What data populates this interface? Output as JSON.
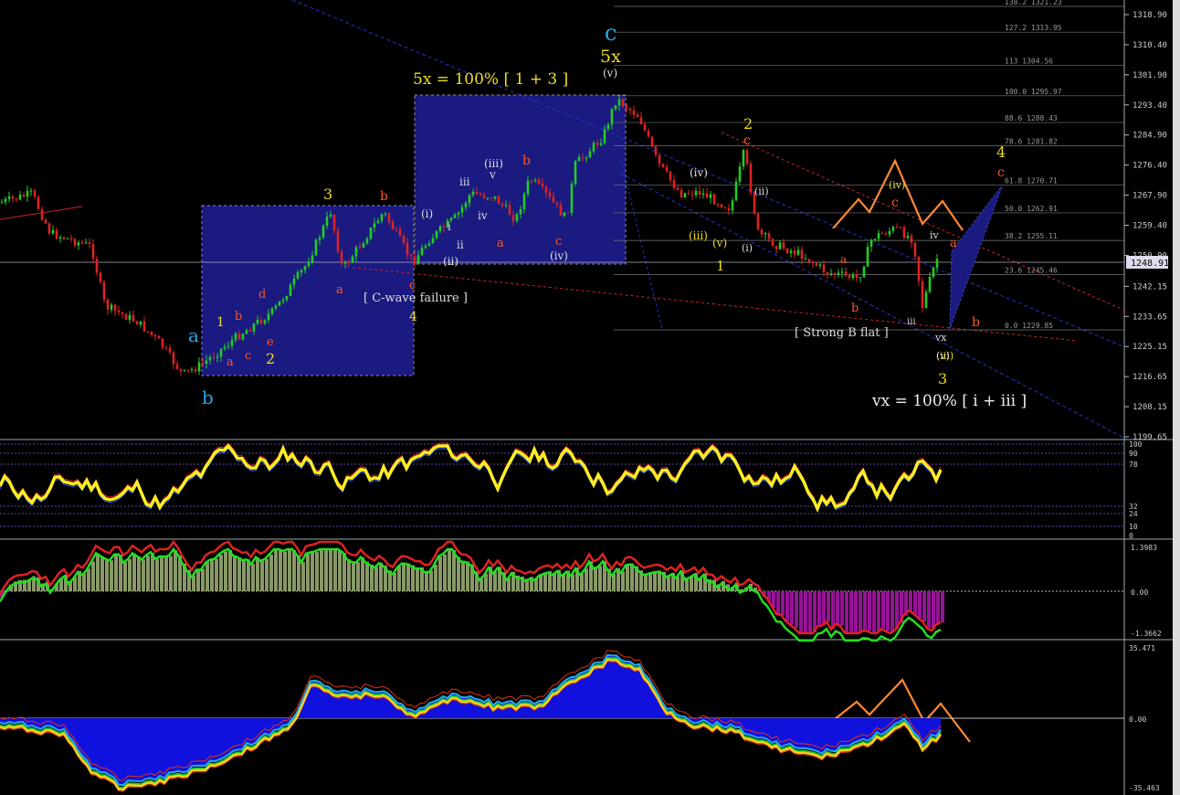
{
  "chart_data": {
    "type": "line",
    "main": {
      "y_axis_labels": [
        "1318.90",
        "1310.40",
        "1301.90",
        "1293.40",
        "1284.90",
        "1276.40",
        "1267.90",
        "1259.40",
        "1250.90",
        "1242.15",
        "1233.65",
        "1225.15",
        "1216.65",
        "1208.15",
        "1199.65"
      ],
      "current_price": "1248.91",
      "fib_levels": [
        {
          "label": "138.2 1321.23",
          "value": 1321.23
        },
        {
          "label": "127.2 1313.95",
          "value": 1313.95
        },
        {
          "label": "113 1304.56",
          "value": 1304.56
        },
        {
          "label": "100.0 1295.97",
          "value": 1295.97
        },
        {
          "label": "88.6 1288.43",
          "value": 1288.43
        },
        {
          "label": "78.6 1281.82",
          "value": 1281.82
        },
        {
          "label": "61.8 1270.71",
          "value": 1270.71
        },
        {
          "label": "50.0 1262.91",
          "value": 1262.91
        },
        {
          "label": "38.2 1255.11",
          "value": 1255.11
        },
        {
          "label": "23.6 1245.46",
          "value": 1245.46
        },
        {
          "label": "0.0 1229.85",
          "value": 1229.85
        }
      ],
      "annotations": {
        "five_x": "5x = 100% [ 1 + 3 ]",
        "c_wave": "[ C-wave failure ]",
        "strong_b": "[ Strong B flat ]",
        "vx": "vx = 100% [ i + iii ]"
      },
      "wave_labels": [
        {
          "t": "c",
          "c": "#22aaee"
        },
        {
          "t": "5x",
          "c": "#eedd22"
        },
        {
          "t": "a",
          "c": "#22aaee"
        },
        {
          "t": "b",
          "c": "#22aaee"
        },
        {
          "t": "3",
          "c": "#eedd22"
        },
        {
          "t": "b",
          "c": "#ff5522"
        },
        {
          "t": "a",
          "c": "#ff5522"
        },
        {
          "t": "c",
          "c": "#ff5522"
        },
        {
          "t": "4",
          "c": "#eedd22"
        },
        {
          "t": "1",
          "c": "#eedd22"
        },
        {
          "t": "2",
          "c": "#eedd22"
        },
        {
          "t": "b",
          "c": "#ff5522"
        },
        {
          "t": "c",
          "c": "#ff5522"
        },
        {
          "t": "a",
          "c": "#ff5522"
        },
        {
          "t": "d",
          "c": "#ff5522"
        },
        {
          "t": "e",
          "c": "#ff5522"
        },
        {
          "t": "(i)",
          "c": "#dddddd"
        },
        {
          "t": "(ii)",
          "c": "#dddddd"
        },
        {
          "t": "(iii)",
          "c": "#dddddd"
        },
        {
          "t": "(iv)",
          "c": "#dddddd"
        },
        {
          "t": "(v)",
          "c": "#dddddd"
        },
        {
          "t": "i",
          "c": "#dddddd"
        },
        {
          "t": "ii",
          "c": "#dddddd"
        },
        {
          "t": "iii",
          "c": "#dddddd"
        },
        {
          "t": "iv",
          "c": "#dddddd"
        },
        {
          "t": "v",
          "c": "#dddddd"
        },
        {
          "t": "a",
          "c": "#ff5522"
        },
        {
          "t": "b",
          "c": "#ff5522"
        },
        {
          "t": "c",
          "c": "#ff5522"
        },
        {
          "t": "(iii)",
          "c": "#eedd22"
        },
        {
          "t": "(iv)",
          "c": "#dddddd"
        },
        {
          "t": "2",
          "c": "#eedd22"
        },
        {
          "t": "c",
          "c": "#ff5522"
        },
        {
          "t": "1",
          "c": "#eedd22"
        },
        {
          "t": "(v)",
          "c": "#eedd22"
        },
        {
          "t": "(iii)",
          "c": "#eedd22"
        },
        {
          "t": "(iv)",
          "c": "#eedd22"
        },
        {
          "t": "(i)",
          "c": "#dddddd"
        },
        {
          "t": "(ii)",
          "c": "#dddddd"
        },
        {
          "t": "a",
          "c": "#ff5522"
        },
        {
          "t": "b",
          "c": "#ff5522"
        },
        {
          "t": "c",
          "c": "#ff5522"
        },
        {
          "t": "iv",
          "c": "#dddddd"
        },
        {
          "t": "iii",
          "c": "#dddddd"
        },
        {
          "t": "vx",
          "c": "#dddddd"
        },
        {
          "t": "(v)",
          "c": "#dddddd"
        },
        {
          "t": "3",
          "c": "#eedd22"
        },
        {
          "t": "4",
          "c": "#eedd22"
        },
        {
          "t": "c",
          "c": "#ff5522"
        },
        {
          "t": "b",
          "c": "#ff5522"
        },
        {
          "t": "a",
          "c": "#ff5522"
        }
      ]
    },
    "rsi": {
      "y_axis_labels": [
        "100",
        "90",
        "78",
        "32",
        "24",
        "10",
        "0"
      ]
    },
    "macd": {
      "y_axis_labels": [
        "1.3983",
        "0.00",
        "-1.3662"
      ]
    },
    "osc": {
      "y_axis_labels": [
        "35.471",
        "0.00",
        "-35.463"
      ]
    }
  }
}
